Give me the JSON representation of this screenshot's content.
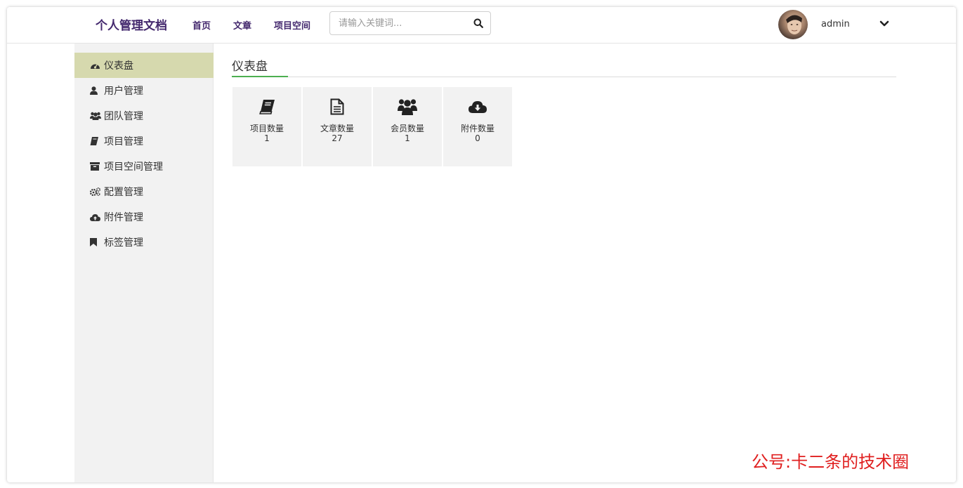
{
  "navbar": {
    "brand": "个人管理文档",
    "links": [
      "首页",
      "文章",
      "项目空间"
    ],
    "search_placeholder": "请输入关键词...",
    "username": "admin"
  },
  "sidebar": {
    "items": [
      {
        "label": "仪表盘",
        "icon": "dashboard-icon",
        "active": true
      },
      {
        "label": "用户管理",
        "icon": "user-icon"
      },
      {
        "label": "团队管理",
        "icon": "users-icon"
      },
      {
        "label": "项目管理",
        "icon": "book-icon"
      },
      {
        "label": "项目空间管理",
        "icon": "archive-icon"
      },
      {
        "label": "配置管理",
        "icon": "gears-icon"
      },
      {
        "label": "附件管理",
        "icon": "cloud-upload-icon"
      },
      {
        "label": "标签管理",
        "icon": "bookmark-icon"
      }
    ]
  },
  "main": {
    "title": "仪表盘",
    "cards": [
      {
        "label": "项目数量",
        "value": "1",
        "icon": "book-icon"
      },
      {
        "label": "文章数量",
        "value": "27",
        "icon": "file-text-icon"
      },
      {
        "label": "会员数量",
        "value": "1",
        "icon": "users-icon"
      },
      {
        "label": "附件数量",
        "value": "0",
        "icon": "cloud-download-icon"
      }
    ]
  },
  "watermark": "公号:卡二条的技术圈",
  "colors": {
    "brand": "#44296e",
    "sidebar_bg": "#f2f2f2",
    "sidebar_active": "#d6d9ae",
    "title_accent": "#4caf50",
    "card_bg": "#f2f2f2",
    "watermark": "#e02020"
  }
}
